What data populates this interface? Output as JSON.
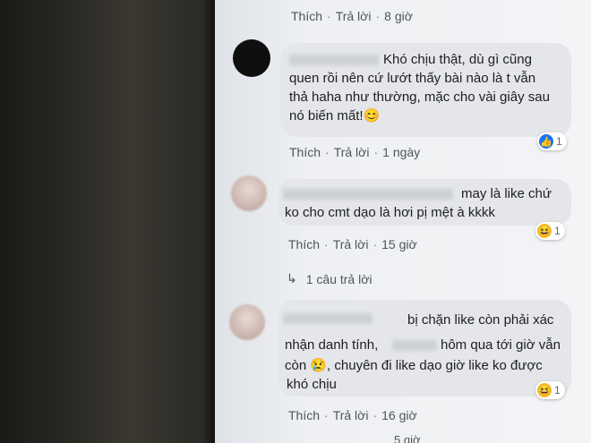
{
  "comments": [
    {
      "actions": {
        "like": "Thích",
        "reply": "Trả lời",
        "time": "8 giờ"
      }
    },
    {
      "text_lines": [
        "Khó chịu thật, dù gì cũng",
        "quen rồi nên cứ lướt thấy bài nào là t vẫn",
        "thả haha như thường, mặc cho vài giây sau",
        "nó biến mất!"
      ],
      "emoji": "😊",
      "reaction": {
        "icon": "like-icon",
        "count": "1"
      },
      "actions": {
        "like": "Thích",
        "reply": "Trả lời",
        "time": "1 ngày"
      }
    },
    {
      "text_lines": [
        "may là like chứ",
        "ko cho cmt dạo là hơi pị mệt à kkkk"
      ],
      "reaction": {
        "icon": "haha-icon",
        "count": "1"
      },
      "actions": {
        "like": "Thích",
        "reply": "Trả lời",
        "time": "15 giờ"
      },
      "replies": "1 câu trả lời"
    },
    {
      "text_lines": [
        "bị chặn like còn phải xác",
        "nhận danh tính,",
        "hôm qua tới giờ vẫn",
        "còn",
        ", chuyên đi like dạo giờ like ko được",
        "khó chịu"
      ],
      "emoji": "😢",
      "reaction": {
        "icon": "haha-icon",
        "count": "1"
      },
      "actions": {
        "like": "Thích",
        "reply": "Trả lời",
        "time": "16 giờ"
      }
    }
  ],
  "partial_bottom": {
    "time": "5 giờ"
  },
  "colors": {
    "bubble": "#e4e6ea",
    "like_blue": "#1877f2",
    "haha_yellow": "#f7b928"
  }
}
